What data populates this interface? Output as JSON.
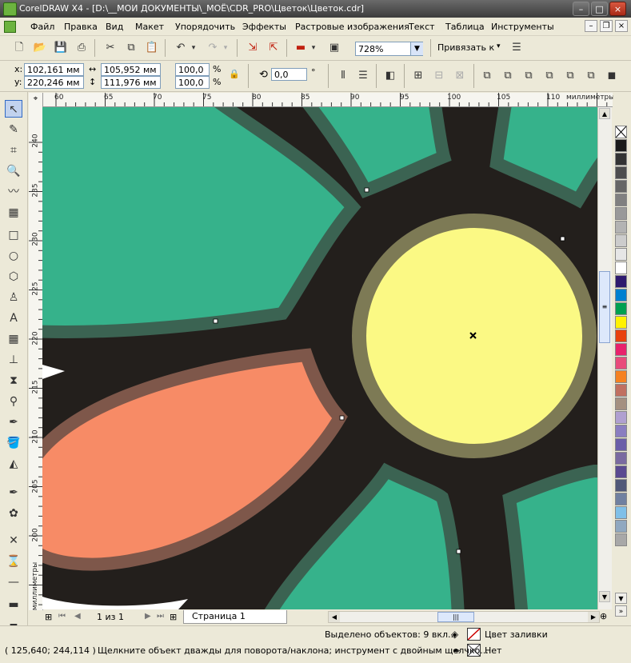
{
  "window": {
    "title": "CorelDRAW X4 - [D:\\__МОИ ДОКУМЕНТЫ\\_МОЁ\\CDR_PRO\\Цветок\\Цветок.cdr]",
    "minimize": "–",
    "maximize": "□",
    "close": "×",
    "mdi_min": "–",
    "mdi_restore": "❐",
    "mdi_close": "×"
  },
  "menu": {
    "items": [
      "Файл",
      "Правка",
      "Вид",
      "Макет",
      "Упорядочить",
      "Эффекты",
      "Растровые изображения",
      "Текст",
      "Таблица",
      "Инструменты"
    ]
  },
  "toolbar": {
    "zoom_value": "728%",
    "snap_label": "Привязать к",
    "snap_arrow": "▾",
    "icons": [
      "new-icon",
      "open-icon",
      "save-icon",
      "print-icon",
      "cut-icon",
      "copy-icon",
      "paste-icon",
      "undo-icon",
      "redo-icon",
      "import-icon",
      "export-icon",
      "application-launcher-icon",
      "welcome-screen-icon",
      "zoom-dropdown-icon",
      "snap-icon",
      "options-icon"
    ]
  },
  "properties": {
    "x_label": "x:",
    "y_label": "y:",
    "x_value": "102,161 мм",
    "y_value": "220,246 мм",
    "width_value": "105,952 мм",
    "height_value": "111,976 мм",
    "scale_x": "100,0",
    "scale_y": "100,0",
    "percent": "%",
    "rotation": "0,0",
    "degree": "°"
  },
  "ruler": {
    "units": "миллиметры",
    "top_labels": [
      "60",
      "65",
      "70",
      "75",
      "80",
      "85",
      "90",
      "95",
      "100",
      "105",
      "110"
    ],
    "left_labels": [
      "240",
      "235",
      "230",
      "225",
      "220",
      "215",
      "210",
      "205",
      "200"
    ]
  },
  "pager": {
    "page_count": "1 из 1",
    "page_tab": "Страница 1"
  },
  "status": {
    "selection": "Выделено объектов: 9 вкл...",
    "fill_label": "Цвет заливки",
    "outline_label": "Нет",
    "coords": "( 125,640; 244,114 )",
    "hint": "Щелкните объект дважды для поворота/наклона; инструмент с двойным щелчко..."
  },
  "colors": {
    "petal_green": "#36b28b",
    "petal_green_outline": "#3b6352",
    "petal_salmon": "#f78b66",
    "petal_salmon_outline": "#7e574a",
    "background": "#231f1c",
    "center_yellow": "#fbf984",
    "center_outline": "#7d7a55"
  },
  "palette": [
    "#ffffff",
    "#1a1a1a",
    "#333333",
    "#4d4d4d",
    "#666666",
    "#808080",
    "#999999",
    "#b3b3b3",
    "#cccccc",
    "#e6e6e6",
    "#ffffff",
    "#2e1a6e",
    "#0080d0",
    "#00a050",
    "#fff200",
    "#e8410c",
    "#e8226b",
    "#e84b7a",
    "#f58220",
    "#c07060",
    "#a49080",
    "#b0a0d0",
    "#8a7ec0",
    "#6a5ea8",
    "#7a6aa0",
    "#5a4a90",
    "#505878",
    "#7080a0",
    "#80c0e8",
    "#90a8c0",
    "#a8a8a8"
  ]
}
